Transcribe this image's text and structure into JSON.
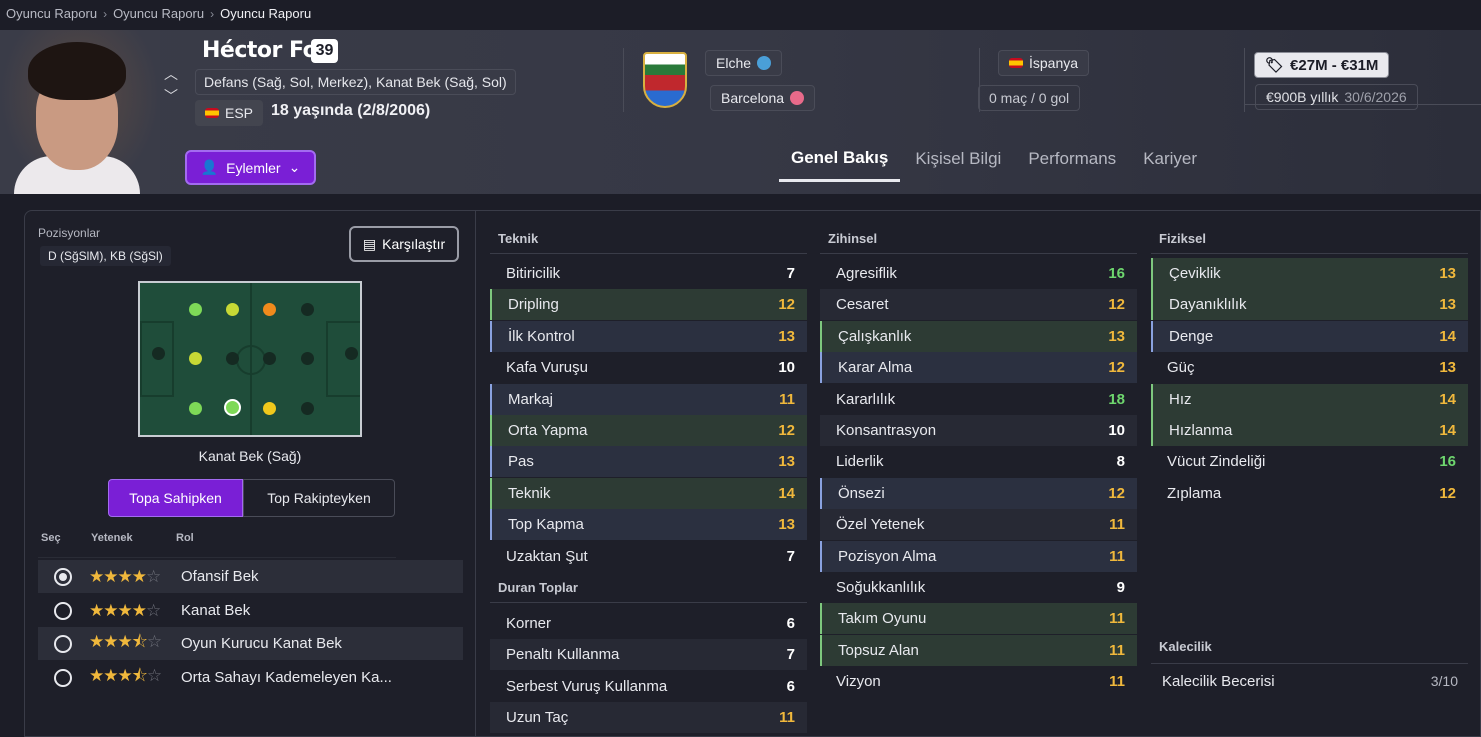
{
  "breadcrumb": {
    "items": [
      "Oyuncu Raporu",
      "Oyuncu Raporu",
      "Oyuncu Raporu"
    ]
  },
  "player": {
    "name": "Héctor Fort",
    "number": "39",
    "positions": "Defans (Sağ, Sol, Merkez), Kanat Bek (Sağ, Sol)",
    "nationality_code": "ESP",
    "age_text": "18 yaşında (2/8/2006)",
    "club": "Elche",
    "parent_club": "Barcelona",
    "country": "İspanya",
    "caps": "0 maç / 0 gol",
    "value_range": "€27M - €31M",
    "wage": "€900B yıllık",
    "contract_end": "30/6/2026"
  },
  "actions_label": "Eylemler",
  "tabs": [
    "Genel Bakış",
    "Kişisel Bilgi",
    "Performans",
    "Kariyer"
  ],
  "active_tab": "Genel Bakış",
  "left": {
    "positions_title": "Pozisyonlar",
    "positions_tag": "D (SğSlM), KB (SğSl)",
    "compare_label": "Karşılaştır",
    "pitch_label": "Kanat Bek (Sağ)",
    "toggle": [
      "Topa Sahipken",
      "Top Rakipteyken"
    ],
    "role_headers": [
      "Seç",
      "Yetenek",
      "Rol"
    ],
    "roles": [
      {
        "name": "Ofansif Bek",
        "stars": 4,
        "selected": true
      },
      {
        "name": "Kanat Bek",
        "stars": 4,
        "selected": false
      },
      {
        "name": "Oyun Kurucu Kanat Bek",
        "stars": 3.5,
        "selected": false
      },
      {
        "name": "Orta Sahayı Kademeleyen Ka...",
        "stars": 3.5,
        "selected": false
      }
    ]
  },
  "attributes": {
    "teknik": {
      "title": "Teknik",
      "items": [
        [
          "Bitiricilik",
          "7"
        ],
        [
          "Dripling",
          "12"
        ],
        [
          "İlk Kontrol",
          "13"
        ],
        [
          "Kafa Vuruşu",
          "10"
        ],
        [
          "Markaj",
          "11"
        ],
        [
          "Orta Yapma",
          "12"
        ],
        [
          "Pas",
          "13"
        ],
        [
          "Teknik",
          "14"
        ],
        [
          "Top Kapma",
          "13"
        ],
        [
          "Uzaktan Şut",
          "7"
        ]
      ]
    },
    "duran": {
      "title": "Duran Toplar",
      "items": [
        [
          "Korner",
          "6"
        ],
        [
          "Penaltı Kullanma",
          "7"
        ],
        [
          "Serbest Vuruş Kullanma",
          "6"
        ],
        [
          "Uzun Taç",
          "11"
        ]
      ]
    },
    "zihinsel": {
      "title": "Zihinsel",
      "items": [
        [
          "Agresiflik",
          "16"
        ],
        [
          "Cesaret",
          "12"
        ],
        [
          "Çalışkanlık",
          "13"
        ],
        [
          "Karar Alma",
          "12"
        ],
        [
          "Kararlılık",
          "18"
        ],
        [
          "Konsantrasyon",
          "10"
        ],
        [
          "Liderlik",
          "8"
        ],
        [
          "Önsezi",
          "12"
        ],
        [
          "Özel Yetenek",
          "11"
        ],
        [
          "Pozisyon Alma",
          "11"
        ],
        [
          "Soğukkanlılık",
          "9"
        ],
        [
          "Takım Oyunu",
          "11"
        ],
        [
          "Topsuz Alan",
          "11"
        ],
        [
          "Vizyon",
          "11"
        ]
      ]
    },
    "fiziksel": {
      "title": "Fiziksel",
      "items": [
        [
          "Çeviklik",
          "13"
        ],
        [
          "Dayanıklılık",
          "13"
        ],
        [
          "Denge",
          "14"
        ],
        [
          "Güç",
          "13"
        ],
        [
          "Hız",
          "14"
        ],
        [
          "Hızlanma",
          "14"
        ],
        [
          "Vücut Zindeliği",
          "16"
        ],
        [
          "Zıplama",
          "12"
        ]
      ]
    },
    "kalecilik": {
      "title": "Kalecilik",
      "label": "Kalecilik Becerisi",
      "value": "3/10"
    }
  },
  "colors": {
    "accent": "#7a1fd6",
    "green": "#6ed66e",
    "orange": "#f0b83c",
    "white": "#ffffff"
  }
}
